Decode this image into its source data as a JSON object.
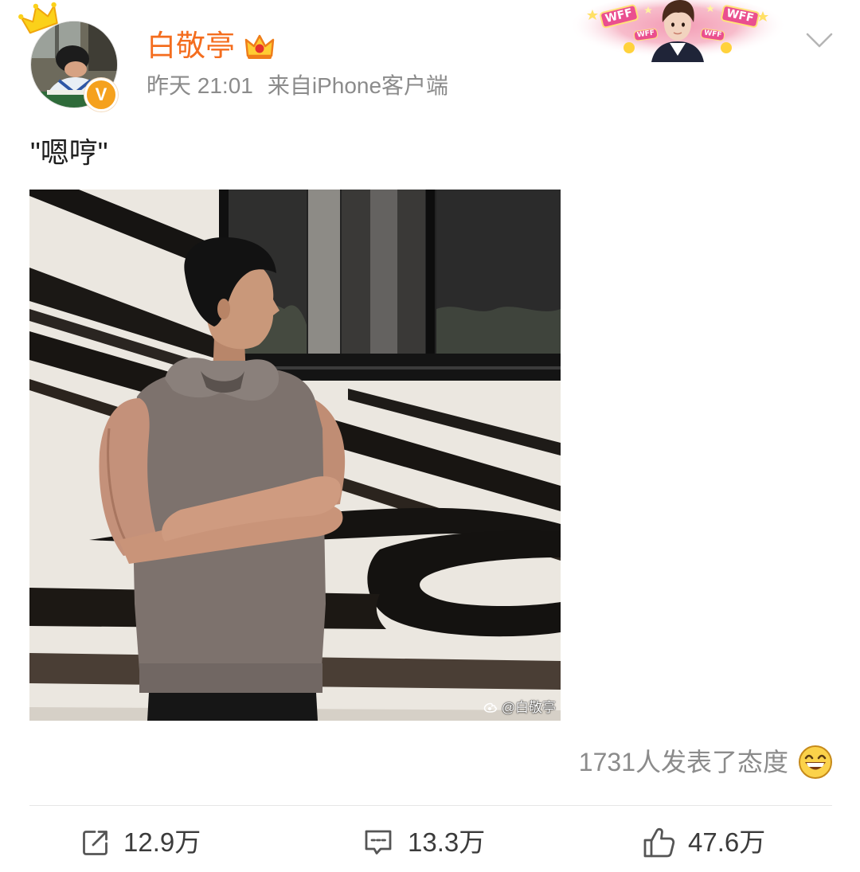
{
  "header": {
    "author_name": "白敬亭",
    "verified_mark": "V",
    "time": "昨天 21:01",
    "source": "来自iPhone客户端",
    "card_decoration": {
      "badge_text": "WFF"
    },
    "icons": {
      "avatar": "avatar-photo",
      "avatar_crown": "crown-icon",
      "vip_badge": "vip-crown-icon",
      "verified": "verified-badge-icon",
      "more": "chevron-down-icon"
    }
  },
  "post": {
    "text": "\"嗯哼\"",
    "photo": {
      "watermark": "@白敬亭",
      "watermark_icon": "weibo-logo-icon"
    }
  },
  "attitudes": {
    "summary": "1731人发表了态度",
    "icon": "laughing-emoji-icon"
  },
  "actions": [
    {
      "icon": "share-icon",
      "count": "12.9万"
    },
    {
      "icon": "comment-icon",
      "count": "13.3万"
    },
    {
      "icon": "thumbs-up-icon",
      "count": "47.6万"
    }
  ],
  "colors": {
    "background": "#ffffff",
    "author_name": "#f46d1e",
    "secondary_text": "#8b8b8b",
    "action_text": "#3b3b3b",
    "verified_badge": "#f5a11d",
    "divider": "#e6e6e6"
  }
}
